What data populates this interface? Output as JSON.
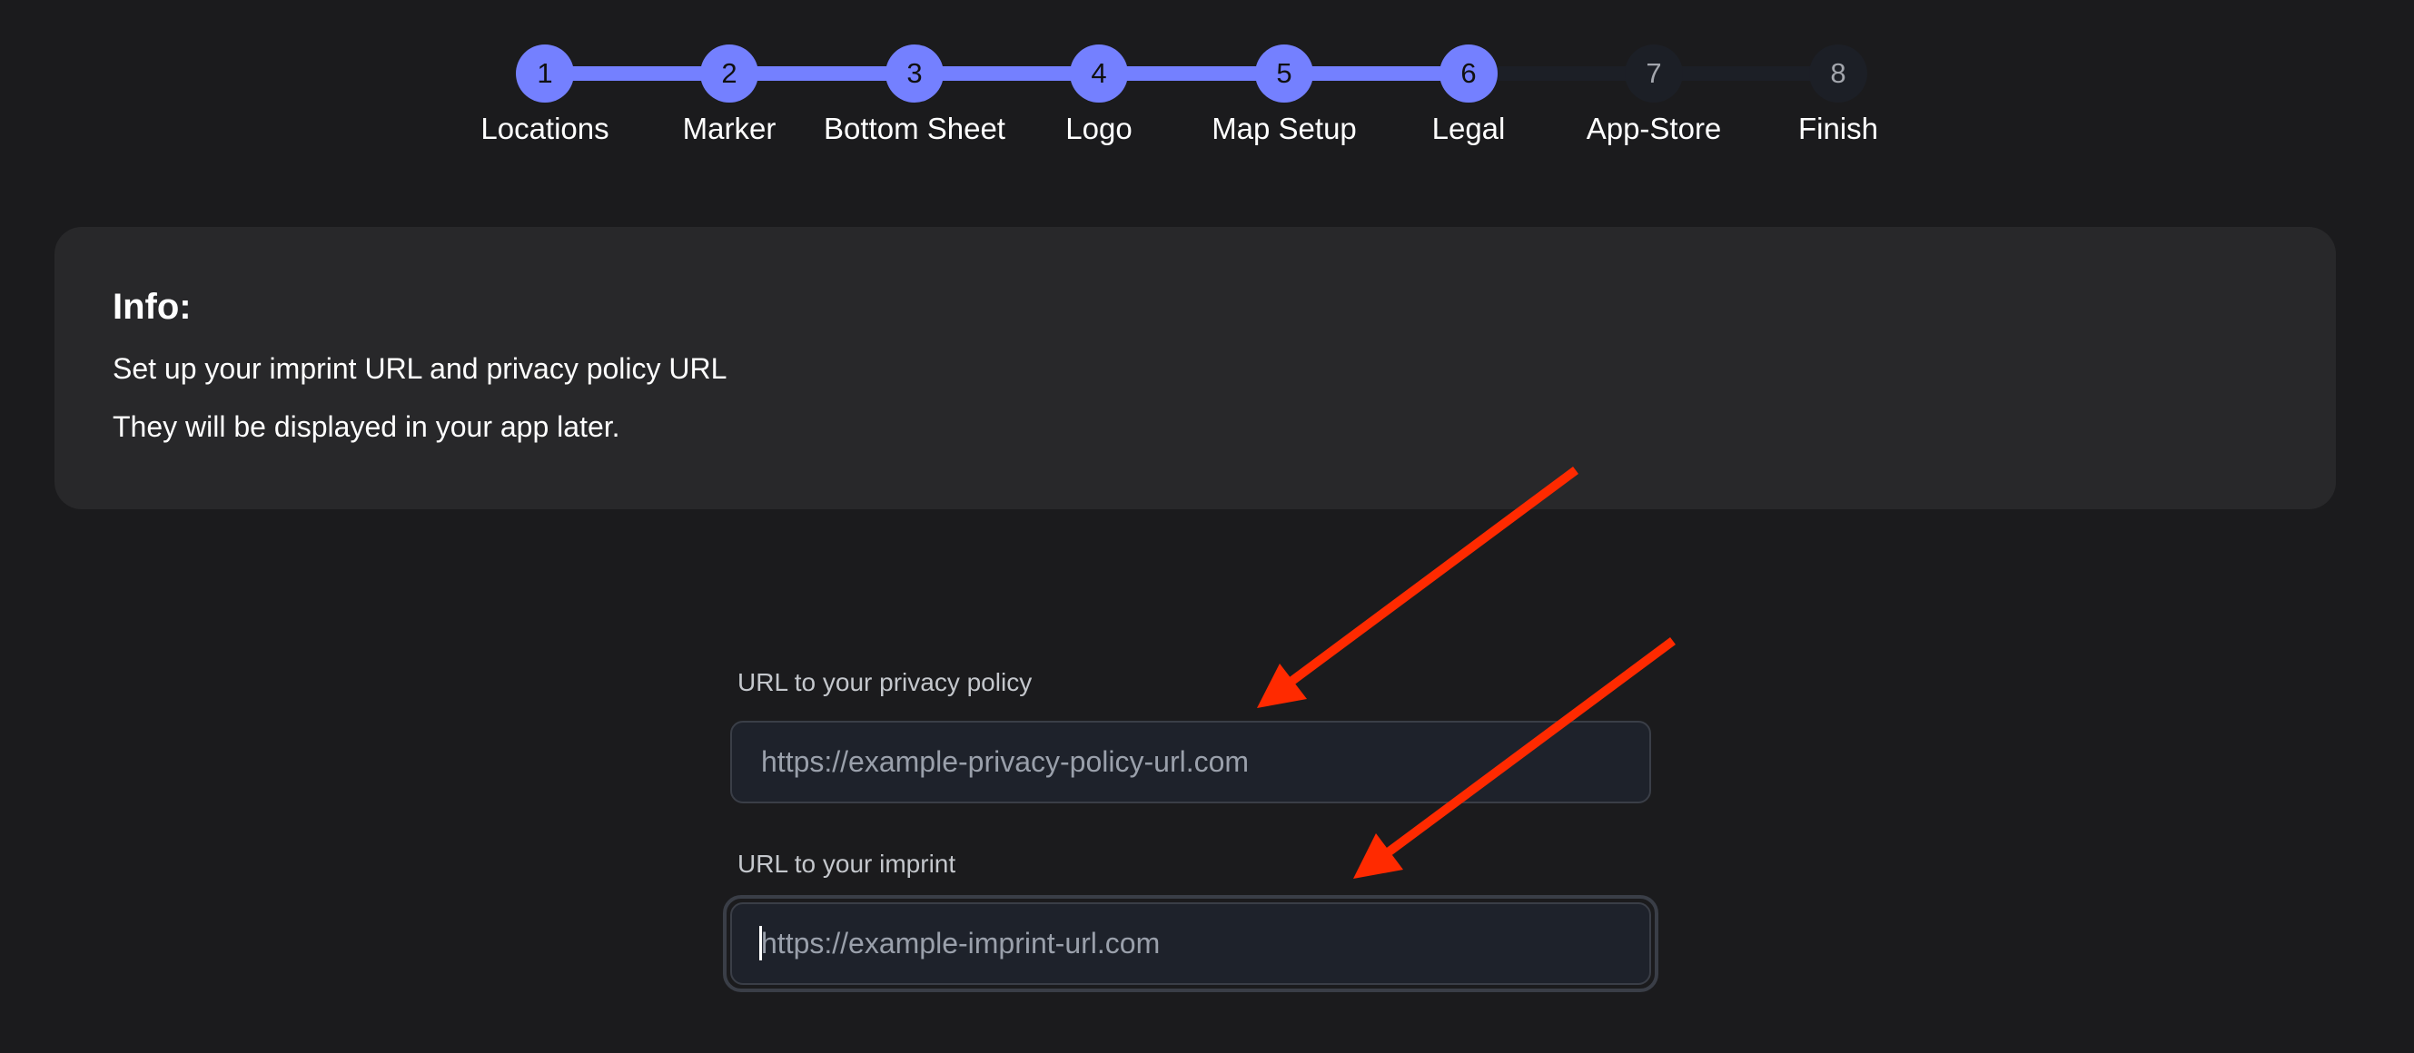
{
  "stepper": {
    "current_step": 6,
    "accent_color": "#7480ff",
    "steps": [
      {
        "number": "1",
        "label": "Locations",
        "state": "done"
      },
      {
        "number": "2",
        "label": "Marker",
        "state": "done"
      },
      {
        "number": "3",
        "label": "Bottom Sheet",
        "state": "done"
      },
      {
        "number": "4",
        "label": "Logo",
        "state": "done"
      },
      {
        "number": "5",
        "label": "Map Setup",
        "state": "done"
      },
      {
        "number": "6",
        "label": "Legal",
        "state": "done"
      },
      {
        "number": "7",
        "label": "App-Store",
        "state": "todo"
      },
      {
        "number": "8",
        "label": "Finish",
        "state": "todo"
      }
    ]
  },
  "info": {
    "title": "Info:",
    "lines": [
      "Set up your imprint URL and privacy policy URL",
      "They will be displayed in your app later."
    ]
  },
  "form": {
    "privacy": {
      "label": "URL to your privacy policy",
      "value": "",
      "placeholder": "https://example-privacy-policy-url.com"
    },
    "imprint": {
      "label": "URL to your imprint",
      "value": "",
      "placeholder": "https://example-imprint-url.com",
      "focused": true
    }
  },
  "annotations": {
    "arrow_color": "#ff2a00",
    "arrows": [
      {
        "points_to": "privacy-policy-url-input"
      },
      {
        "points_to": "imprint-url-input"
      }
    ]
  }
}
